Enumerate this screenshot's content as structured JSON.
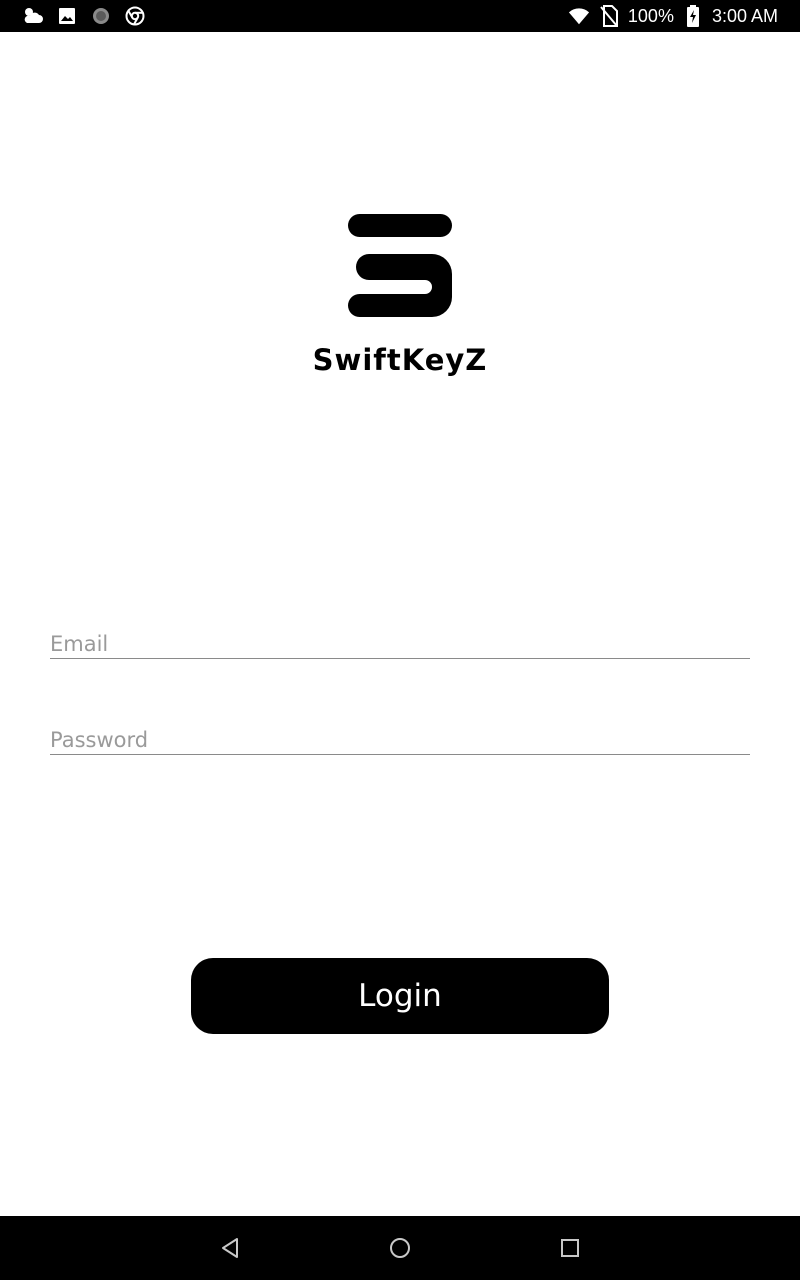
{
  "status_bar": {
    "battery_percent": "100%",
    "time": "3:00 AM",
    "icons": [
      "weather-icon",
      "image-icon",
      "circle-notification-icon",
      "chrome-icon",
      "wifi-icon",
      "no-sim-icon",
      "battery-charging-icon"
    ]
  },
  "app": {
    "name": "SwiftKeyZ",
    "logo_icon": "swiftkeyz-logo"
  },
  "form": {
    "email": {
      "placeholder": "Email",
      "value": ""
    },
    "password": {
      "placeholder": "Password",
      "value": ""
    },
    "login_label": "Login"
  },
  "nav_bar": {
    "buttons": [
      "back",
      "home",
      "recents"
    ]
  },
  "colors": {
    "background": "#ffffff",
    "primary": "#000000",
    "placeholder": "#9a9a9a",
    "underline": "#8a8a8a"
  }
}
